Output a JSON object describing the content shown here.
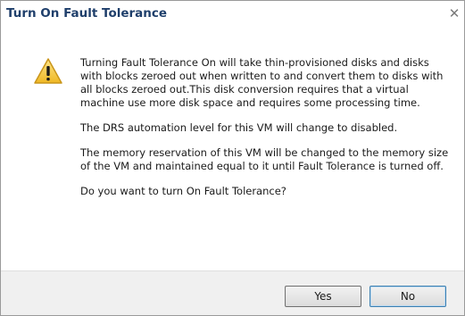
{
  "dialog": {
    "title": "Turn On Fault Tolerance",
    "close_glyph": "✕",
    "icon": "warning-icon",
    "paragraphs": [
      "Turning Fault Tolerance On will take thin-provisioned disks and disks with blocks zeroed out when written to and convert them to disks with all blocks zeroed out.This disk conversion requires that a virtual machine use more disk space and requires some processing time.",
      "The DRS automation level for this VM will change to disabled.",
      "The memory reservation of this VM will be changed to the memory size of the VM and maintained equal to it until Fault Tolerance is turned off.",
      "Do you want to turn On Fault Tolerance?"
    ],
    "buttons": {
      "yes_label": "Yes",
      "no_label": "No"
    }
  },
  "colors": {
    "title": "#1f3f6b",
    "warning_fill": "#f2c744",
    "warning_border": "#c9951a",
    "footer": "#f0f0f0"
  }
}
